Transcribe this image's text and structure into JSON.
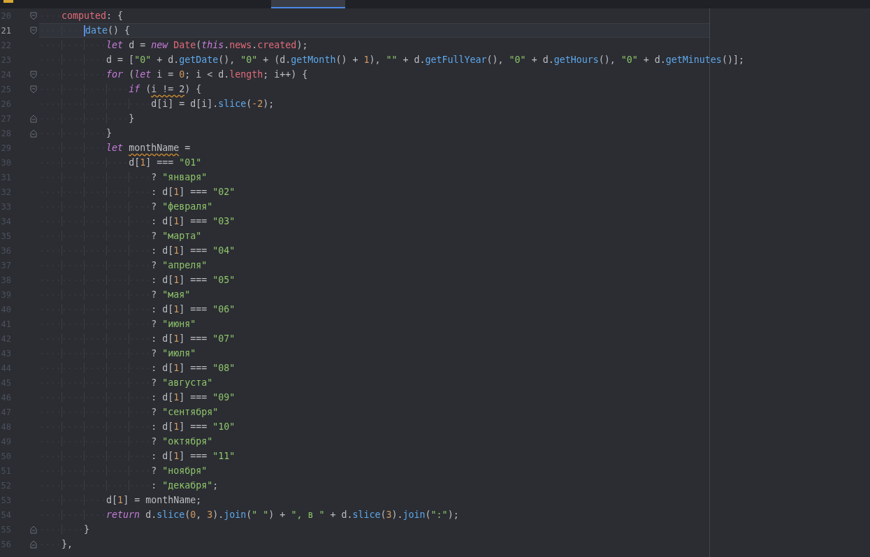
{
  "editor": {
    "lines": [
      {
        "number": "20",
        "kind": "block-start",
        "current": false,
        "tokens": [
          {
            "kind": "property",
            "text": "    computed"
          },
          {
            "kind": "plain",
            "text": ": {"
          }
        ]
      },
      {
        "number": "21",
        "kind": "block-start",
        "current": true,
        "tokens": [
          {
            "kind": "method",
            "text": "        date"
          },
          {
            "kind": "plain",
            "text": "() {"
          }
        ]
      },
      {
        "number": "22",
        "kind": "code",
        "current": false,
        "tokens": [
          {
            "kind": "keyword",
            "text": "            let"
          },
          {
            "kind": "plain",
            "text": " d = "
          },
          {
            "kind": "keyword",
            "text": "new"
          },
          {
            "kind": "property",
            "text": " Date"
          },
          {
            "kind": "plain",
            "text": "("
          },
          {
            "kind": "keyword",
            "text": "this"
          },
          {
            "kind": "plain",
            "text": "."
          },
          {
            "kind": "property",
            "text": "news"
          },
          {
            "kind": "plain",
            "text": "."
          },
          {
            "kind": "property",
            "text": "created"
          },
          {
            "kind": "plain",
            "text": ");"
          }
        ]
      },
      {
        "number": "23",
        "kind": "code",
        "current": false,
        "tokens": [
          {
            "kind": "plain",
            "text": "            d = ["
          },
          {
            "kind": "string",
            "text": "\"0\""
          },
          {
            "kind": "plain",
            "text": " + d."
          },
          {
            "kind": "method",
            "text": "getDate"
          },
          {
            "kind": "plain",
            "text": "(), "
          },
          {
            "kind": "string",
            "text": "\"0\""
          },
          {
            "kind": "plain",
            "text": " + (d."
          },
          {
            "kind": "method",
            "text": "getMonth"
          },
          {
            "kind": "plain",
            "text": "() + "
          },
          {
            "kind": "number",
            "text": "1"
          },
          {
            "kind": "plain",
            "text": "), "
          },
          {
            "kind": "string",
            "text": "\"\""
          },
          {
            "kind": "plain",
            "text": " + d."
          },
          {
            "kind": "method",
            "text": "getFullYear"
          },
          {
            "kind": "plain",
            "text": "(), "
          },
          {
            "kind": "string",
            "text": "\"0\""
          },
          {
            "kind": "plain",
            "text": " + d."
          },
          {
            "kind": "method",
            "text": "getHours"
          },
          {
            "kind": "plain",
            "text": "(), "
          },
          {
            "kind": "string",
            "text": "\"0\""
          },
          {
            "kind": "plain",
            "text": " + d."
          },
          {
            "kind": "method",
            "text": "getMinutes"
          },
          {
            "kind": "plain",
            "text": "()];"
          }
        ]
      },
      {
        "number": "24",
        "kind": "block-start",
        "current": false,
        "tokens": [
          {
            "kind": "keyword",
            "text": "            for"
          },
          {
            "kind": "plain",
            "text": " ("
          },
          {
            "kind": "keyword",
            "text": "let"
          },
          {
            "kind": "plain",
            "text": " i = "
          },
          {
            "kind": "number",
            "text": "0"
          },
          {
            "kind": "plain",
            "text": "; i < d."
          },
          {
            "kind": "property",
            "text": "length"
          },
          {
            "kind": "plain",
            "text": "; i++) {"
          }
        ]
      },
      {
        "number": "25",
        "kind": "block-start",
        "current": false,
        "tokens": [
          {
            "kind": "keyword",
            "text": "                if"
          },
          {
            "kind": "plain",
            "text": " ("
          },
          {
            "kind": "flagged",
            "text": "i != 2"
          },
          {
            "kind": "plain",
            "text": ") {"
          }
        ]
      },
      {
        "number": "26",
        "kind": "code",
        "current": false,
        "tokens": [
          {
            "kind": "plain",
            "text": "                    d[i] = d[i]."
          },
          {
            "kind": "method",
            "text": "slice"
          },
          {
            "kind": "plain",
            "text": "("
          },
          {
            "kind": "number",
            "text": "-2"
          },
          {
            "kind": "plain",
            "text": ");"
          }
        ]
      },
      {
        "number": "27",
        "kind": "block-end",
        "current": false,
        "tokens": [
          {
            "kind": "plain",
            "text": "                }"
          }
        ]
      },
      {
        "number": "28",
        "kind": "block-end",
        "current": false,
        "tokens": [
          {
            "kind": "plain",
            "text": "            }"
          }
        ]
      },
      {
        "number": "29",
        "kind": "code",
        "current": false,
        "tokens": [
          {
            "kind": "keyword",
            "text": "            let "
          },
          {
            "kind": "flagged",
            "text": "monthName"
          },
          {
            "kind": "plain",
            "text": " ="
          }
        ]
      },
      {
        "number": "30",
        "kind": "code",
        "current": false,
        "tokens": [
          {
            "kind": "plain",
            "text": "                d["
          },
          {
            "kind": "number",
            "text": "1"
          },
          {
            "kind": "plain",
            "text": "] === "
          },
          {
            "kind": "string",
            "text": "\"01\""
          }
        ]
      },
      {
        "number": "31",
        "kind": "code",
        "current": false,
        "tokens": [
          {
            "kind": "plain",
            "text": "                    ? "
          },
          {
            "kind": "string",
            "text": "\"января\""
          }
        ]
      },
      {
        "number": "32",
        "kind": "code",
        "current": false,
        "tokens": [
          {
            "kind": "plain",
            "text": "                    : d["
          },
          {
            "kind": "number",
            "text": "1"
          },
          {
            "kind": "plain",
            "text": "] === "
          },
          {
            "kind": "string",
            "text": "\"02\""
          }
        ]
      },
      {
        "number": "33",
        "kind": "code",
        "current": false,
        "tokens": [
          {
            "kind": "plain",
            "text": "                    ? "
          },
          {
            "kind": "string",
            "text": "\"февраля\""
          }
        ]
      },
      {
        "number": "34",
        "kind": "code",
        "current": false,
        "tokens": [
          {
            "kind": "plain",
            "text": "                    : d["
          },
          {
            "kind": "number",
            "text": "1"
          },
          {
            "kind": "plain",
            "text": "] === "
          },
          {
            "kind": "string",
            "text": "\"03\""
          }
        ]
      },
      {
        "number": "35",
        "kind": "code",
        "current": false,
        "tokens": [
          {
            "kind": "plain",
            "text": "                    ? "
          },
          {
            "kind": "string",
            "text": "\"марта\""
          }
        ]
      },
      {
        "number": "36",
        "kind": "code",
        "current": false,
        "tokens": [
          {
            "kind": "plain",
            "text": "                    : d["
          },
          {
            "kind": "number",
            "text": "1"
          },
          {
            "kind": "plain",
            "text": "] === "
          },
          {
            "kind": "string",
            "text": "\"04\""
          }
        ]
      },
      {
        "number": "37",
        "kind": "code",
        "current": false,
        "tokens": [
          {
            "kind": "plain",
            "text": "                    ? "
          },
          {
            "kind": "string",
            "text": "\"апреля\""
          }
        ]
      },
      {
        "number": "38",
        "kind": "code",
        "current": false,
        "tokens": [
          {
            "kind": "plain",
            "text": "                    : d["
          },
          {
            "kind": "number",
            "text": "1"
          },
          {
            "kind": "plain",
            "text": "] === "
          },
          {
            "kind": "string",
            "text": "\"05\""
          }
        ]
      },
      {
        "number": "39",
        "kind": "code",
        "current": false,
        "tokens": [
          {
            "kind": "plain",
            "text": "                    ? "
          },
          {
            "kind": "string",
            "text": "\"мая\""
          }
        ]
      },
      {
        "number": "40",
        "kind": "code",
        "current": false,
        "tokens": [
          {
            "kind": "plain",
            "text": "                    : d["
          },
          {
            "kind": "number",
            "text": "1"
          },
          {
            "kind": "plain",
            "text": "] === "
          },
          {
            "kind": "string",
            "text": "\"06\""
          }
        ]
      },
      {
        "number": "41",
        "kind": "code",
        "current": false,
        "tokens": [
          {
            "kind": "plain",
            "text": "                    ? "
          },
          {
            "kind": "string",
            "text": "\"июня\""
          }
        ]
      },
      {
        "number": "42",
        "kind": "code",
        "current": false,
        "tokens": [
          {
            "kind": "plain",
            "text": "                    : d["
          },
          {
            "kind": "number",
            "text": "1"
          },
          {
            "kind": "plain",
            "text": "] === "
          },
          {
            "kind": "string",
            "text": "\"07\""
          }
        ]
      },
      {
        "number": "43",
        "kind": "code",
        "current": false,
        "tokens": [
          {
            "kind": "plain",
            "text": "                    ? "
          },
          {
            "kind": "string",
            "text": "\"июля\""
          }
        ]
      },
      {
        "number": "44",
        "kind": "code",
        "current": false,
        "tokens": [
          {
            "kind": "plain",
            "text": "                    : d["
          },
          {
            "kind": "number",
            "text": "1"
          },
          {
            "kind": "plain",
            "text": "] === "
          },
          {
            "kind": "string",
            "text": "\"08\""
          }
        ]
      },
      {
        "number": "45",
        "kind": "code",
        "current": false,
        "tokens": [
          {
            "kind": "plain",
            "text": "                    ? "
          },
          {
            "kind": "string",
            "text": "\"августа\""
          }
        ]
      },
      {
        "number": "46",
        "kind": "code",
        "current": false,
        "tokens": [
          {
            "kind": "plain",
            "text": "                    : d["
          },
          {
            "kind": "number",
            "text": "1"
          },
          {
            "kind": "plain",
            "text": "] === "
          },
          {
            "kind": "string",
            "text": "\"09\""
          }
        ]
      },
      {
        "number": "47",
        "kind": "code",
        "current": false,
        "tokens": [
          {
            "kind": "plain",
            "text": "                    ? "
          },
          {
            "kind": "string",
            "text": "\"сентября\""
          }
        ]
      },
      {
        "number": "48",
        "kind": "code",
        "current": false,
        "tokens": [
          {
            "kind": "plain",
            "text": "                    : d["
          },
          {
            "kind": "number",
            "text": "1"
          },
          {
            "kind": "plain",
            "text": "] === "
          },
          {
            "kind": "string",
            "text": "\"10\""
          }
        ]
      },
      {
        "number": "49",
        "kind": "code",
        "current": false,
        "tokens": [
          {
            "kind": "plain",
            "text": "                    ? "
          },
          {
            "kind": "string",
            "text": "\"октября\""
          }
        ]
      },
      {
        "number": "50",
        "kind": "code",
        "current": false,
        "tokens": [
          {
            "kind": "plain",
            "text": "                    : d["
          },
          {
            "kind": "number",
            "text": "1"
          },
          {
            "kind": "plain",
            "text": "] === "
          },
          {
            "kind": "string",
            "text": "\"11\""
          }
        ]
      },
      {
        "number": "51",
        "kind": "code",
        "current": false,
        "tokens": [
          {
            "kind": "plain",
            "text": "                    ? "
          },
          {
            "kind": "string",
            "text": "\"ноября\""
          }
        ]
      },
      {
        "number": "52",
        "kind": "code",
        "current": false,
        "tokens": [
          {
            "kind": "plain",
            "text": "                    : "
          },
          {
            "kind": "string",
            "text": "\"декабря\""
          },
          {
            "kind": "plain",
            "text": ";"
          }
        ]
      },
      {
        "number": "53",
        "kind": "code",
        "current": false,
        "tokens": [
          {
            "kind": "plain",
            "text": "            d["
          },
          {
            "kind": "number",
            "text": "1"
          },
          {
            "kind": "plain",
            "text": "] = monthName;"
          }
        ]
      },
      {
        "number": "54",
        "kind": "code",
        "current": false,
        "tokens": [
          {
            "kind": "keyword",
            "text": "            return"
          },
          {
            "kind": "plain",
            "text": " d."
          },
          {
            "kind": "method",
            "text": "slice"
          },
          {
            "kind": "plain",
            "text": "("
          },
          {
            "kind": "number",
            "text": "0"
          },
          {
            "kind": "plain",
            "text": ", "
          },
          {
            "kind": "number",
            "text": "3"
          },
          {
            "kind": "plain",
            "text": ")."
          },
          {
            "kind": "method",
            "text": "join"
          },
          {
            "kind": "plain",
            "text": "("
          },
          {
            "kind": "string",
            "text": "\" \""
          },
          {
            "kind": "plain",
            "text": ") + "
          },
          {
            "kind": "string",
            "text": "\", в \""
          },
          {
            "kind": "plain",
            "text": " + d."
          },
          {
            "kind": "method",
            "text": "slice"
          },
          {
            "kind": "plain",
            "text": "("
          },
          {
            "kind": "number",
            "text": "3"
          },
          {
            "kind": "plain",
            "text": ")."
          },
          {
            "kind": "method",
            "text": "join"
          },
          {
            "kind": "plain",
            "text": "("
          },
          {
            "kind": "string",
            "text": "\":\""
          },
          {
            "kind": "plain",
            "text": ");"
          }
        ]
      },
      {
        "number": "55",
        "kind": "block-end",
        "current": false,
        "tokens": [
          {
            "kind": "plain",
            "text": "        }"
          }
        ]
      },
      {
        "number": "56",
        "kind": "block-end",
        "current": false,
        "tokens": [
          {
            "kind": "plain",
            "text": "    },"
          }
        ]
      }
    ]
  }
}
